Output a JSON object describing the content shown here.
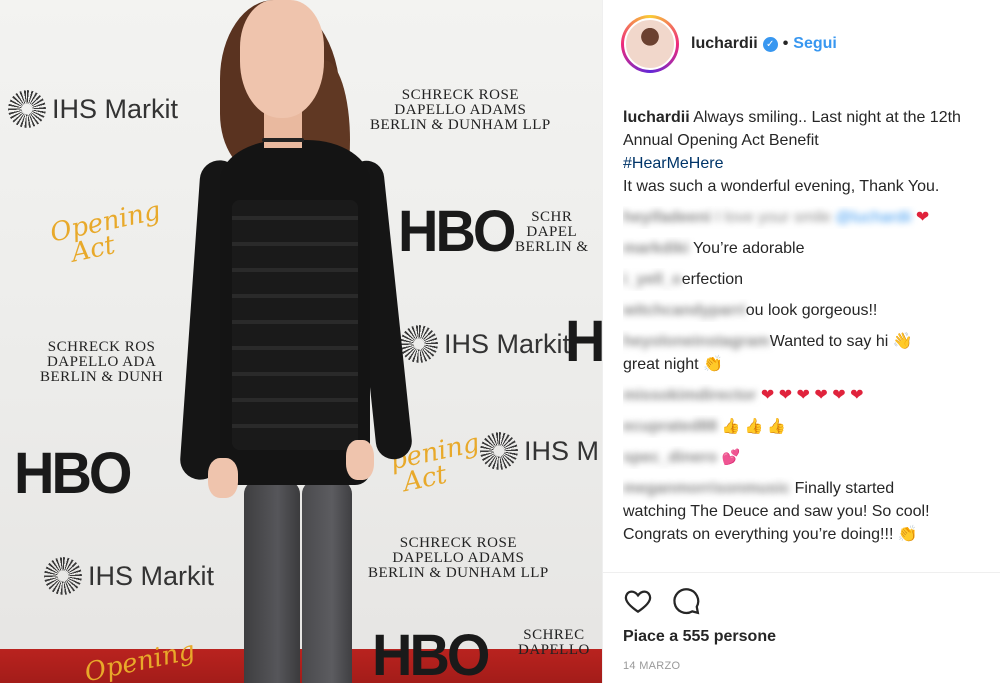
{
  "photo": {
    "backdrop_logos": {
      "hbo": "HBO",
      "ihs": "IHS Markit",
      "law": "SCHRECK ROSE\nDAPELLO ADAMS\nBERLIN & DUNHAM LLP",
      "act": "Opening\nAct"
    }
  },
  "header": {
    "username": "luchardii",
    "separator": "•",
    "follow_label": "Segui"
  },
  "caption": {
    "username": "luchardii",
    "text": "Always smiling.. Last night at the 12th Annual Opening Act Benefit",
    "hashtag": "#HearMeHere",
    "text2": "It was such a wonderful evening, Thank You."
  },
  "comments": [
    {
      "user": "heyifadeeni",
      "text": "I love your smile",
      "mention": "@luchardii",
      "suffix": "❤"
    },
    {
      "user": "markdiki",
      "text": "You’re adorable"
    },
    {
      "user": "i_yell_o",
      "text": "erfection"
    },
    {
      "user": "witchcandyparri",
      "text": "ou look gorgeous!!"
    },
    {
      "user": "heyoloneinstagram",
      "text": "Wanted to say hi 👋",
      "text2": "great night 👏"
    },
    {
      "user": "missokimdirector",
      "text": "❤ ❤ ❤ ❤ ❤ ❤"
    },
    {
      "user": "ecuprated88",
      "text": "👍 👍 👍"
    },
    {
      "user": "spec_dinero",
      "text": "💕"
    },
    {
      "user": "meganmorrisonmusic",
      "text": "Finally started",
      "text2": "watching The Deuce and saw you! So cool!",
      "text3": "Congrats on everything you’re doing!!! 👏"
    }
  ],
  "footer": {
    "likes": "Piace a 555 persone",
    "date": "14 MARZO"
  },
  "icons": {
    "like": "heart-outline-icon",
    "comment": "speech-bubble-icon",
    "verified": "verified-badge-icon"
  },
  "colors": {
    "link_blue": "#3897f0",
    "hashtag": "#003569",
    "heart": "#e0233c"
  }
}
